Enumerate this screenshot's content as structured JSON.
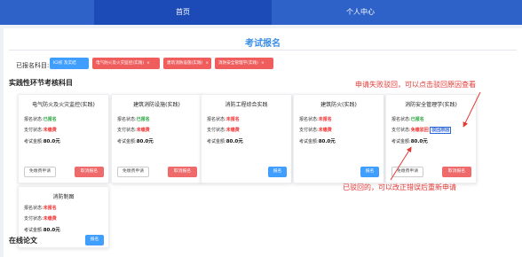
{
  "nav": {
    "tabs": [
      "首页",
      "个人中心"
    ]
  },
  "page": {
    "title": "考试报名"
  },
  "selected": {
    "label": "已报名科目:",
    "tags": [
      {
        "text": "K2初 及实结",
        "color": "#409eff",
        "removable": false
      },
      {
        "text": "电气防火及火灾监控(实践)",
        "color": "#ef5d5d",
        "removable": true
      },
      {
        "text": "建筑消防设施(实践)",
        "color": "#ef5d5d",
        "removable": true
      },
      {
        "text": "消防安全管理学(实践)",
        "color": "#ef5d5d",
        "removable": true
      }
    ],
    "remove_symbol": "×"
  },
  "section_practice": "实践性环节考核科目",
  "section_thesis": "在线论文",
  "labels": {
    "status": "报名状态:",
    "pay": "支付状态:",
    "fee": "考试金额:"
  },
  "cards": [
    {
      "title": "电气防火及火灾监控(实践)",
      "status": "已报名",
      "pay": "未缴费",
      "fee": "80.0元",
      "buttons": [
        "免缴费申请",
        "取消报名"
      ]
    },
    {
      "title": "建筑消防设施(实践)",
      "status": "已报名",
      "pay": "未缴费",
      "fee": "80.0元",
      "buttons": [
        "免缴费申请",
        "取消报名"
      ]
    },
    {
      "title": "消防工程综合实践",
      "status": "未报名",
      "pay": "未缴费",
      "fee": "80.0元",
      "buttons": [
        "报名"
      ]
    },
    {
      "title": "建筑防火(实践)",
      "status": "未报名",
      "pay": "未缴费",
      "fee": "80.0元",
      "buttons": [
        "报名"
      ]
    },
    {
      "title": "消防安全管理学(实践)",
      "status": "已报名",
      "pay": "免缴驳回",
      "pay_link": "驳回原因",
      "fee": "80.0元",
      "buttons": [
        "免缴费申请",
        "取消报名"
      ]
    },
    {
      "title": "消防制图",
      "status": "未报名",
      "pay": "未缴费",
      "fee": "80.0元",
      "buttons": [
        "报名"
      ]
    }
  ],
  "annotations": {
    "note1": "申请失败驳回，可以点击驳回原因查看",
    "note2": "已驳回的，可以改正错误后重新申请"
  },
  "colors": {
    "nav": "#2f62c9",
    "accent": "#409eff",
    "danger": "#ef5d5d",
    "success": "#2aa541",
    "note": "#e53935"
  }
}
